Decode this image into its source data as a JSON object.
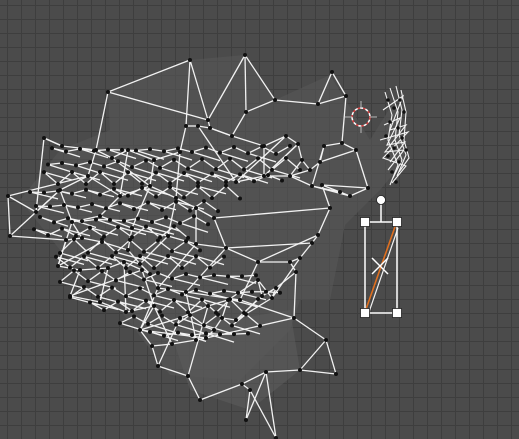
{
  "editor": {
    "type": "2d-uv-vertex-editor",
    "grid": true,
    "colors": {
      "background": "#4b4b4b",
      "grid_line": "#3e3e3e",
      "edge": "#f2f2f2",
      "vertex": "#111111",
      "face_fill": "#5a5a5a",
      "cursor": "#d94444",
      "gizmo": "#ffffff",
      "selected_edge": "#e07020"
    }
  },
  "cursor": {
    "icon": "3d-cursor-icon"
  },
  "transform_gizmo": {
    "icon": "scale-gizmo-icon",
    "handles": [
      "top-left",
      "top-right",
      "bottom-left",
      "bottom-right",
      "rotate"
    ]
  }
}
